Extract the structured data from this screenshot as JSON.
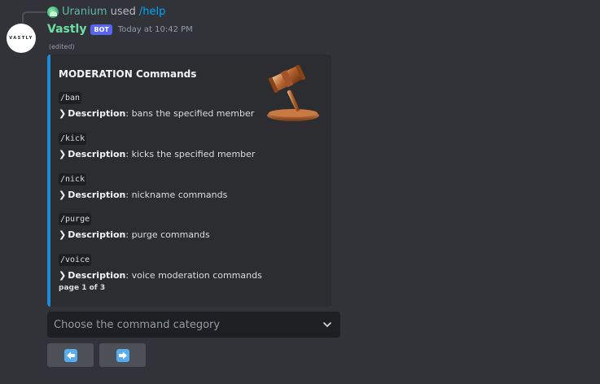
{
  "reply": {
    "user": "Uranium",
    "used": "used",
    "command": "/help"
  },
  "author": {
    "avatar_text": "VASTLY",
    "name": "Vastly",
    "bot_tag": "BOT",
    "timestamp": "Today at 10:42 PM",
    "edited": "(edited)"
  },
  "embed": {
    "color": "#1f8bd6",
    "title": "MODERATION Commands",
    "thumbnail_icon": "gavel-icon",
    "commands": [
      {
        "code": "/ban",
        "chevron": "❯",
        "label": "Description",
        "text": ": bans the specified member"
      },
      {
        "code": "/kick",
        "chevron": "❯",
        "label": "Description",
        "text": ": kicks the specified member"
      },
      {
        "code": "/nick",
        "chevron": "❯",
        "label": "Description",
        "text": ": nickname commands"
      },
      {
        "code": "/purge",
        "chevron": "❯",
        "label": "Description",
        "text": ": purge commands"
      },
      {
        "code": "/voice",
        "chevron": "❯",
        "label": "Description",
        "text": ": voice moderation commands"
      }
    ],
    "footer": "page 1 of 3"
  },
  "select_menu": {
    "placeholder": "Choose the command category",
    "icon": "chevron-down-icon"
  },
  "buttons": {
    "prev_icon": "arrow-left-icon",
    "next_icon": "arrow-right-icon"
  }
}
